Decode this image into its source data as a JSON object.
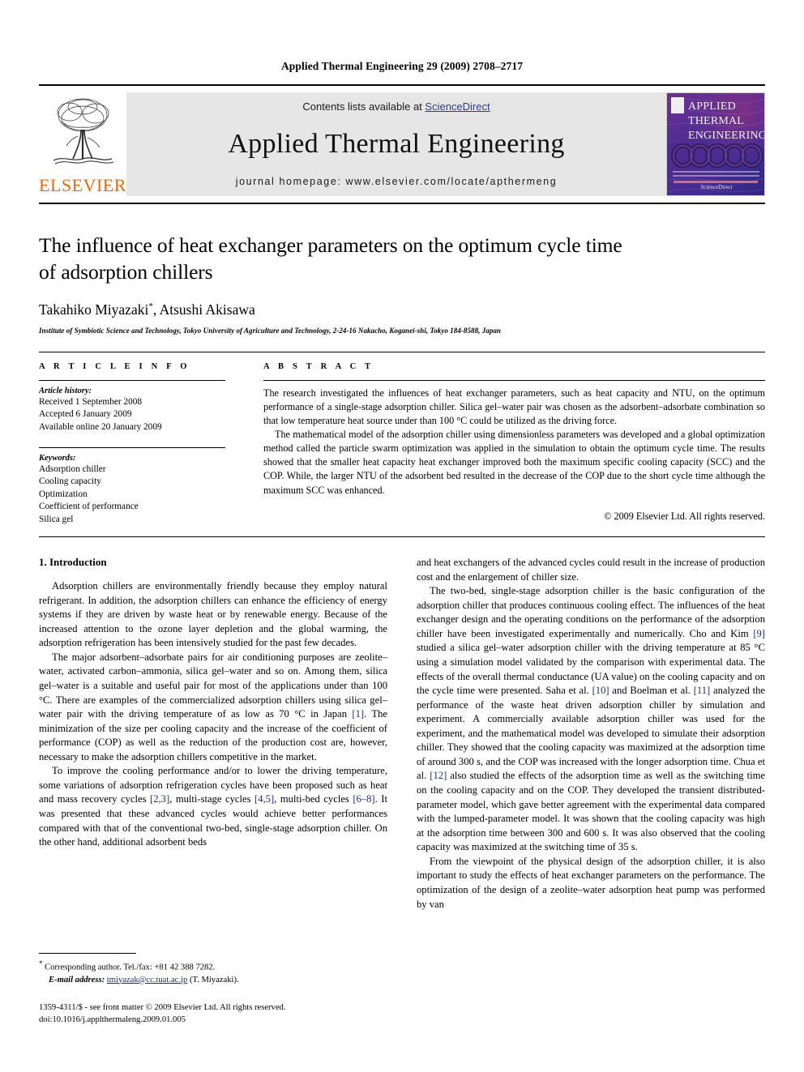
{
  "running_head": "Applied Thermal Engineering 29 (2009) 2708–2717",
  "masthead": {
    "publisher_name": "ELSEVIER",
    "contents_prefix": "Contents lists available at ",
    "sciencedirect": "ScienceDirect",
    "journal_title": "Applied Thermal Engineering",
    "homepage": "journal homepage: www.elsevier.com/locate/apthermeng",
    "cover": {
      "line1": "APPLIED",
      "line2": "THERMAL",
      "line3": "ENGINEERING",
      "bottom_logo": "ScienceDirect"
    }
  },
  "article": {
    "title": "The influence of heat exchanger parameters on the optimum cycle time of adsorption chillers",
    "title_line1": "The influence of heat exchanger parameters on the optimum cycle time",
    "title_line2": "of adsorption chillers",
    "authors": "Takahiko Miyazaki",
    "corresponding_marker": "*",
    "authors_rest": ", Atsushi Akisawa",
    "affiliation": "Institute of Symbiotic Science and Technology, Tokyo University of Agriculture and Technology, 2-24-16 Nakacho, Koganei-shi, Tokyo 184-8588, Japan"
  },
  "article_info": {
    "heading": "A R T I C L E    I N F O",
    "history_heading": "Article history:",
    "history": [
      "Received 1 September 2008",
      "Accepted 6 January 2009",
      "Available online 20 January 2009"
    ],
    "keywords_heading": "Keywords:",
    "keywords": [
      "Adsorption chiller",
      "Cooling capacity",
      "Optimization",
      "Coefficient of performance",
      "Silica gel"
    ]
  },
  "abstract": {
    "heading": "A B S T R A C T",
    "paragraph1": "The research investigated the influences of heat exchanger parameters, such as heat capacity and NTU, on the optimum performance of a single-stage adsorption chiller. Silica gel–water pair was chosen as the adsorbent–adsorbate combination so that low temperature heat source under than 100 °C could be utilized as the driving force.",
    "paragraph2": "The mathematical model of the adsorption chiller using dimensionless parameters was developed and a global optimization method called the particle swarm optimization was applied in the simulation to obtain the optimum cycle time. The results showed that the smaller heat capacity heat exchanger improved both the maximum specific cooling capacity (SCC) and the COP. While, the larger NTU of the adsorbent bed resulted in the decrease of the COP due to the short cycle time although the maximum SCC was enhanced.",
    "copyright": "© 2009 Elsevier Ltd. All rights reserved."
  },
  "introduction": {
    "heading": "1. Introduction",
    "left_paragraphs": [
      "Adsorption chillers are environmentally friendly because they employ natural refrigerant. In addition, the adsorption chillers can enhance the efficiency of energy systems if they are driven by waste heat or by renewable energy. Because of the increased attention to the ozone layer depletion and the global warming, the adsorption refrigeration has been intensively studied for the past few decades.",
      "The major adsorbent–adsorbate pairs for air conditioning purposes are zeolite–water, activated carbon–ammonia, silica gel–water and so on. Among them, silica gel–water is a suitable and useful pair for most of the applications under than 100 °C. There are examples of the commercialized adsorption chillers using silica gel–water pair with the driving temperature of as low as 70 °C in Japan [1]. The minimization of the size per cooling capacity and the increase of the coefficient of performance (COP) as well as the reduction of the production cost are, however, necessary to make the adsorption chillers competitive in the market.",
      "To improve the cooling performance and/or to lower the driving temperature, some variations of adsorption refrigeration cycles have been proposed such as heat and mass recovery cycles [2,3], multi-stage cycles [4,5], multi-bed cycles [6–8]. It was presented that these advanced cycles would achieve better performances compared with that of the conventional two-bed, single-stage adsorption chiller. On the other hand, additional adsorbent beds"
    ],
    "right_paragraphs": [
      "and heat exchangers of the advanced cycles could result in the increase of production cost and the enlargement of chiller size.",
      "The two-bed, single-stage adsorption chiller is the basic configuration of the adsorption chiller that produces continuous cooling effect. The influences of the heat exchanger design and the operating conditions on the performance of the adsorption chiller have been investigated experimentally and numerically. Cho and Kim [9] studied a silica gel–water adsorption chiller with the driving temperature at 85 °C using a simulation model validated by the comparison with experimental data. The effects of the overall thermal conductance (UA value) on the cooling capacity and on the cycle time were presented. Saha et al. [10] and Boelman et al. [11] analyzed the performance of the waste heat driven adsorption chiller by simulation and experiment. A commercially available adsorption chiller was used for the experiment, and the mathematical model was developed to simulate their adsorption chiller. They showed that the cooling capacity was maximized at the adsorption time of around 300 s, and the COP was increased with the longer adsorption time. Chua et al. [12] also studied the effects of the adsorption time as well as the switching time on the cooling capacity and on the COP. They developed the transient distributed-parameter model, which gave better agreement with the experimental data compared with the lumped-parameter model. It was shown that the cooling capacity was high at the adsorption time between 300 and 600 s. It was also observed that the cooling capacity was maximized at the switching time of 35 s.",
      "From the viewpoint of the physical design of the adsorption chiller, it is also important to study the effects of heat exchanger parameters on the performance. The optimization of the design of a zeolite–water adsorption heat pump was performed by van"
    ]
  },
  "footnote": {
    "corresponding": "Corresponding author. Tel./fax: +81 42 388 7282.",
    "email_label": "E-mail address:",
    "email": "tmiyazak@cc.tuat.ac.jp",
    "email_suffix": "(T. Miyazaki)."
  },
  "imprint": {
    "line1": "1359-4311/$ - see front matter © 2009 Elsevier Ltd. All rights reserved.",
    "line2": "doi:10.1016/j.applthermaleng.2009.01.005"
  },
  "colors": {
    "link": "#1c2d8c",
    "sciencedirect": "#2b3c8f",
    "elsevier_orange": "#ec6608",
    "masthead_band": "#e6e6e6"
  }
}
